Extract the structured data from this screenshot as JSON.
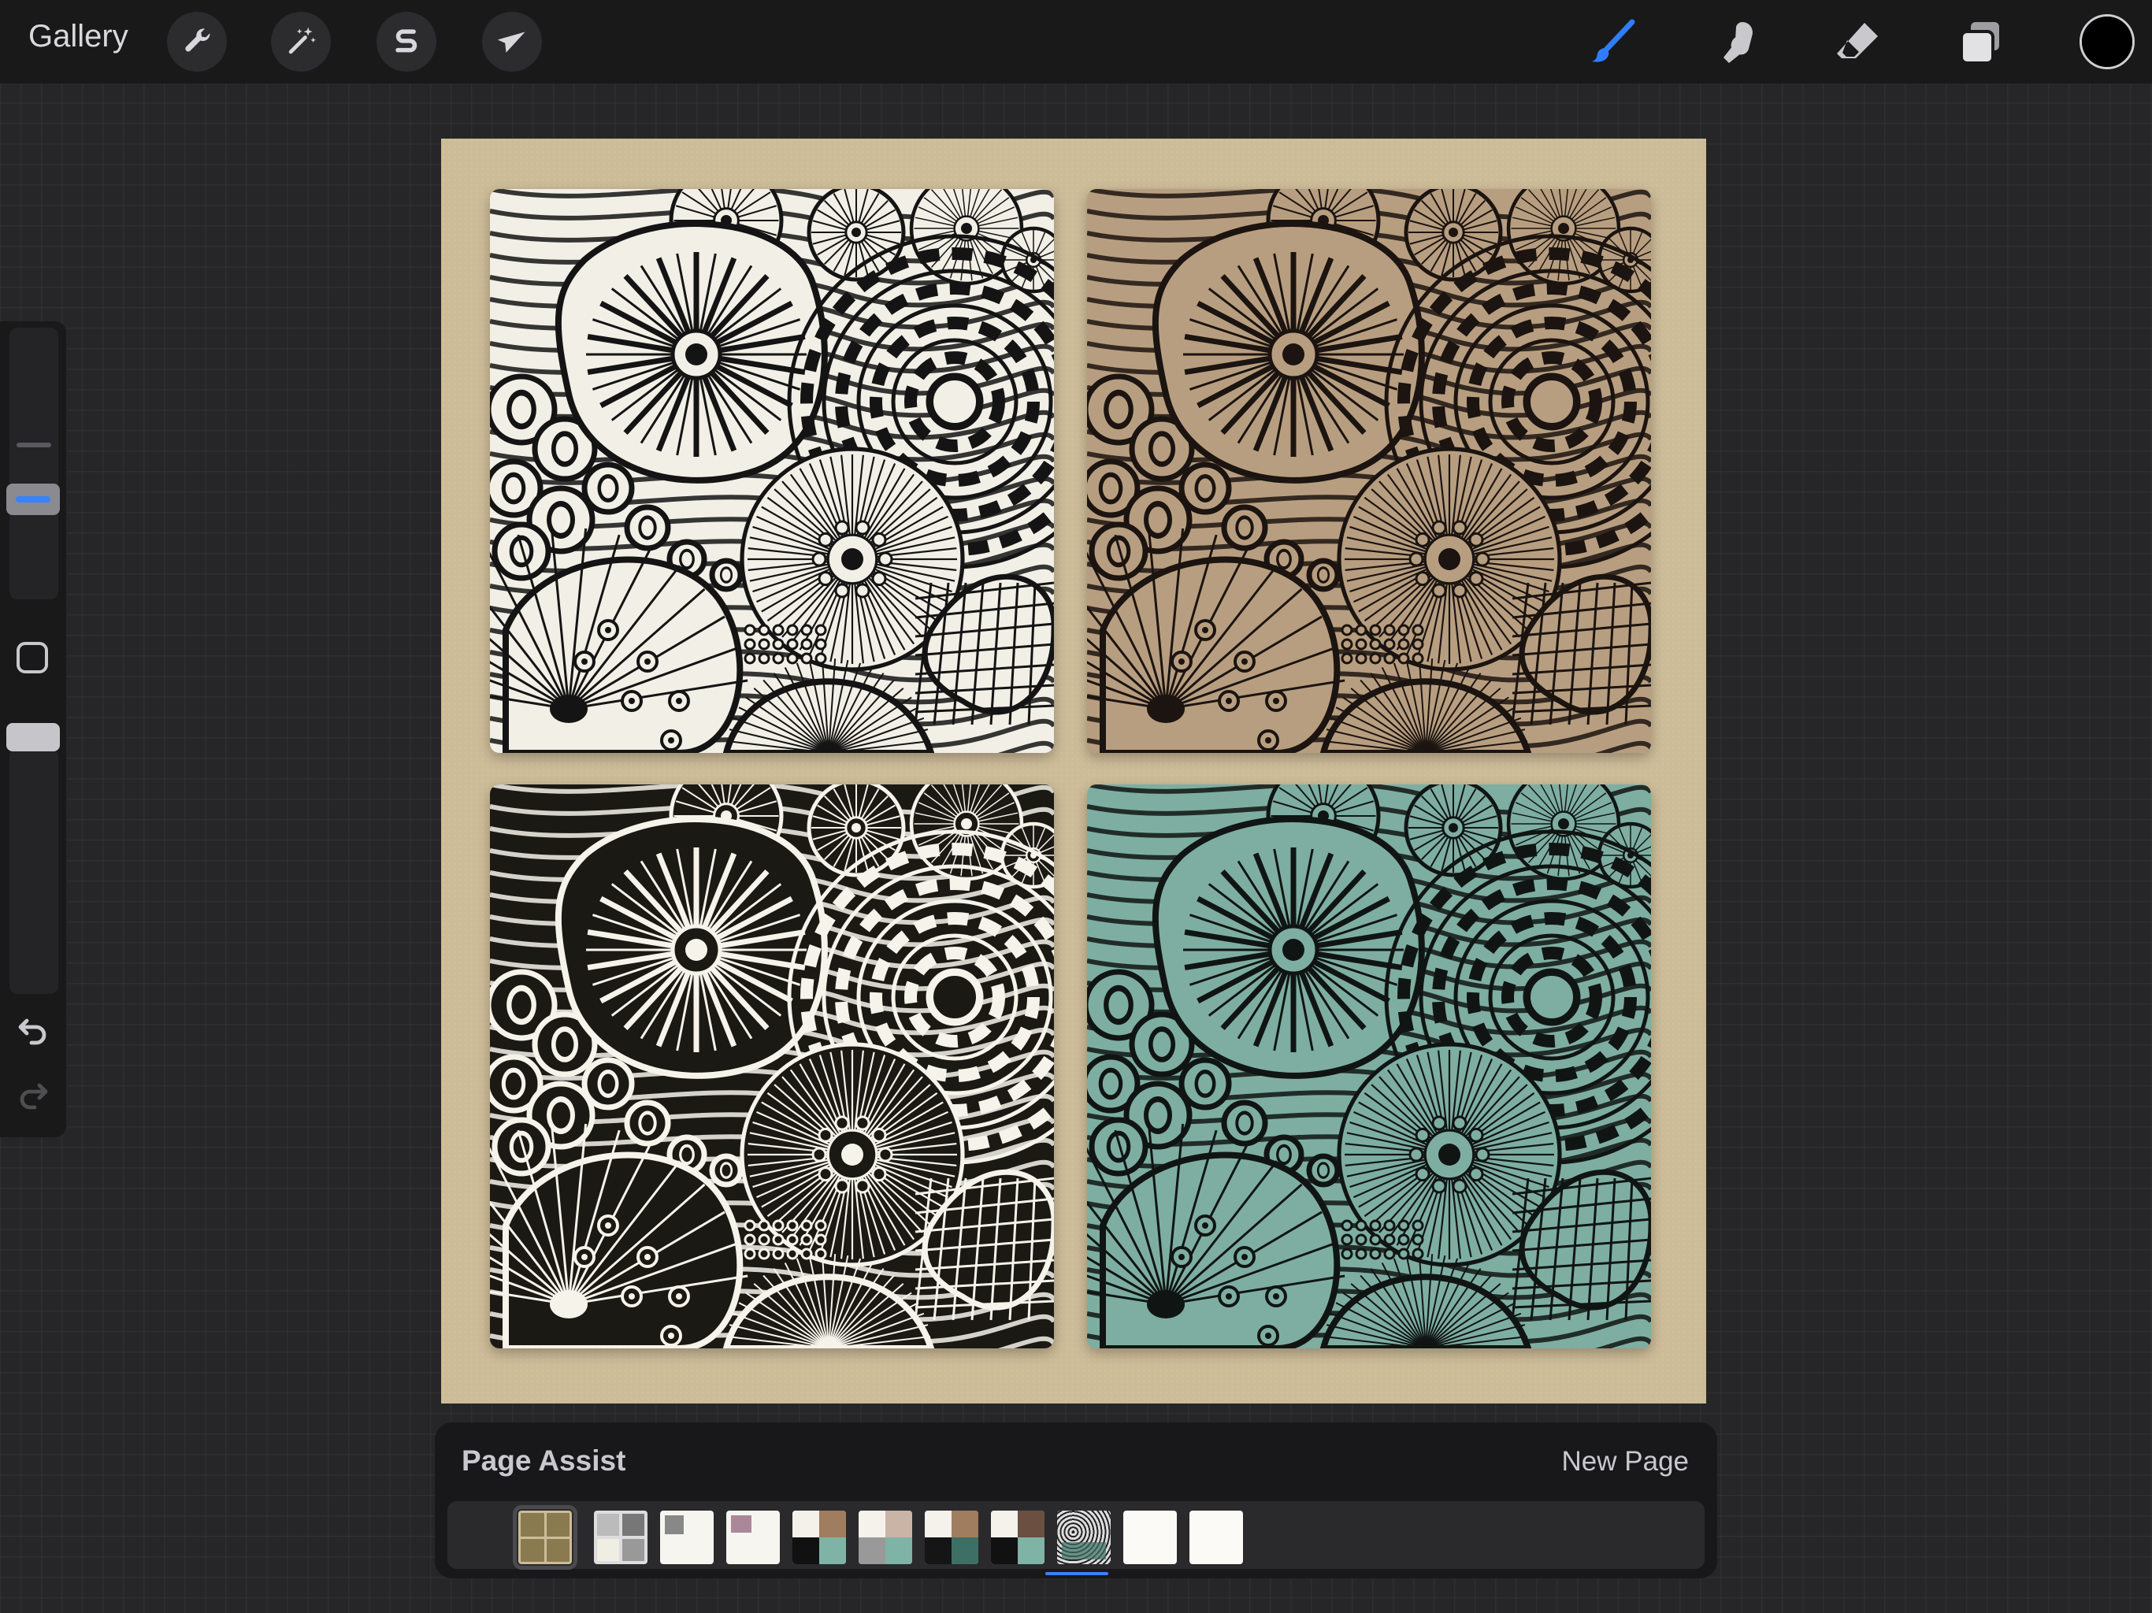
{
  "topbar": {
    "gallery_label": "Gallery",
    "left_tools": [
      {
        "name": "actions",
        "icon": "wrench-icon"
      },
      {
        "name": "adjustments",
        "icon": "magic-wand-icon"
      },
      {
        "name": "selection",
        "icon": "selection-s-icon"
      },
      {
        "name": "transform",
        "icon": "arrow-cursor-icon"
      }
    ],
    "right_tools": [
      {
        "name": "brush",
        "icon": "brush-icon",
        "active": true,
        "color": "#2f7dff"
      },
      {
        "name": "smudge",
        "icon": "smudge-finger-icon"
      },
      {
        "name": "eraser",
        "icon": "eraser-icon"
      },
      {
        "name": "layers",
        "icon": "layers-icon"
      }
    ],
    "current_color": "#000000"
  },
  "sidebar": {
    "brush_size_icon": "size-slider-icon",
    "modify_icon": "square-modify-icon",
    "undo_icon": "undo-arrow-icon",
    "redo_icon": "redo-arrow-icon",
    "accent": "#3b82f6"
  },
  "canvas": {
    "paper_color": "#cdbc98",
    "panels": [
      {
        "variant": "black-on-white",
        "bg": "#f2efe6",
        "ink": "#141414"
      },
      {
        "variant": "black-on-tan",
        "bg": "#b89e80",
        "ink": "#1b1410"
      },
      {
        "variant": "white-on-black",
        "bg": "#1a1914",
        "ink": "#f6f3ea"
      },
      {
        "variant": "black-on-teal",
        "bg": "#7eaea2",
        "ink": "#101513"
      }
    ]
  },
  "page_assist": {
    "title": "Page Assist",
    "new_page_label": "New Page",
    "selected_index": 0,
    "active_index": 8,
    "thumbnails": [
      {
        "kind": "grid-tan"
      },
      {
        "kind": "pattern-mixed"
      },
      {
        "kind": "pattern-small"
      },
      {
        "kind": "pattern-small-2"
      },
      {
        "kind": "quad-tan-teal"
      },
      {
        "kind": "quad-light"
      },
      {
        "kind": "quad-dark-teal"
      },
      {
        "kind": "quad-dark-teal-2"
      },
      {
        "kind": "pattern-dark"
      },
      {
        "kind": "blank"
      },
      {
        "kind": "blank"
      }
    ]
  }
}
